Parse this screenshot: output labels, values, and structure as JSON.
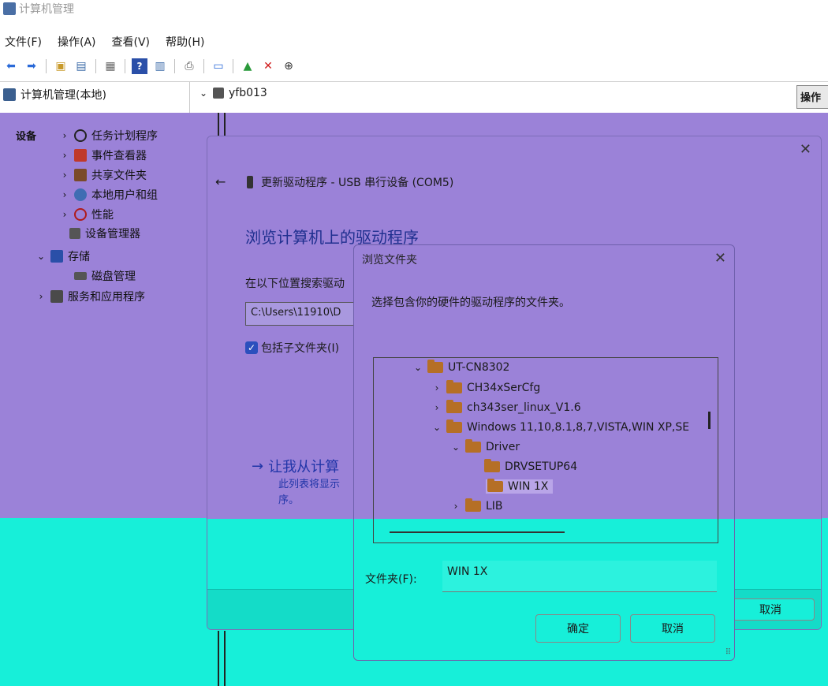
{
  "window": {
    "title": "计算机管理"
  },
  "menu": [
    "文件(F)",
    "操作(A)",
    "查看(V)",
    "帮助(H)"
  ],
  "toolbar_icons": [
    "back-arrow-icon",
    "forward-arrow-icon",
    "up-folder-icon",
    "show-tree-icon",
    "properties-icon",
    "help-icon",
    "view-icon",
    "print-icon",
    "monitor-icon",
    "enable-icon",
    "delete-icon",
    "download-icon"
  ],
  "tree": {
    "root": "计算机管理(本地)",
    "items": [
      "任务计划程序",
      "事件查看器",
      "共享文件夹",
      "本地用户和组",
      "性能",
      "设备管理器",
      "存储",
      "磁盘管理",
      "服务和应用程序"
    ],
    "partial": "设备"
  },
  "device_tree": {
    "computer_node": "yfb013"
  },
  "actions_pane": {
    "header": "操作"
  },
  "update_dialog": {
    "header": "更新驱动程序 - USB 串行设备 (COM5)",
    "heading": "浏览计算机上的驱动程序",
    "search_label": "在以下位置搜索驱动",
    "path": "C:\\Users\\11910\\D",
    "include_subfolders": "包括子文件夹(I)",
    "let_me_pick": "让我从计算",
    "let_me_pick_sub1": "此列表将显示",
    "let_me_pick_sub2": "序。",
    "cancel": "取消"
  },
  "browse_dialog": {
    "title": "浏览文件夹",
    "description": "选择包含你的硬件的驱动程序的文件夹。",
    "folders": [
      "UT-CN8302",
      "CH34xSerCfg",
      "ch343ser_linux_V1.6",
      "Windows 11,10,8.1,8,7,VISTA,WIN XP,SE",
      "Driver",
      "DRVSETUP64",
      "WIN 1X",
      "LIB"
    ],
    "folder_label": "文件夹(F):",
    "folder_value": "WIN 1X",
    "ok": "确定",
    "cancel": "取消"
  },
  "colors": {
    "overlay_purple": "#9b82d8",
    "overlay_teal": "#17efd9",
    "link_blue": "#2135a8",
    "folder_brown": "#b56f26"
  }
}
